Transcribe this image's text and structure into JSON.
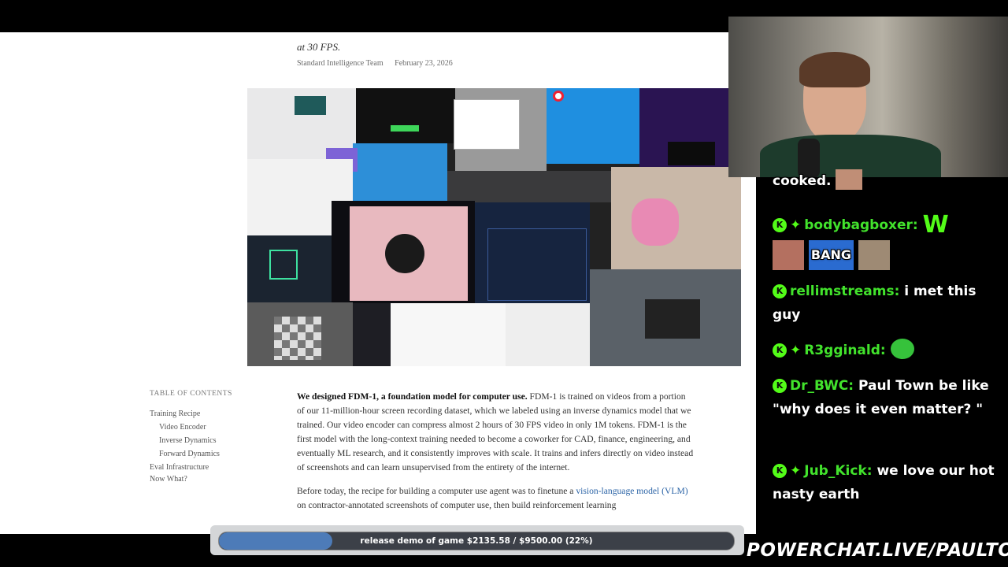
{
  "article": {
    "lede": "at 30 FPS.",
    "author": "Standard Intelligence Team",
    "date": "February 23, 2026",
    "toc": {
      "title": "TABLE OF CONTENTS",
      "items": [
        {
          "label": "Training Recipe",
          "sub": false
        },
        {
          "label": "Video Encoder",
          "sub": true
        },
        {
          "label": "Inverse Dynamics",
          "sub": true
        },
        {
          "label": "Forward Dynamics",
          "sub": true
        },
        {
          "label": "Eval Infrastructure",
          "sub": false
        },
        {
          "label": "Now What?",
          "sub": false
        }
      ]
    },
    "p1_bold": "We designed FDM-1, a foundation model for computer use.",
    "p1_rest": " FDM-1 is trained on videos from a portion of our 11-million-hour screen recording dataset, which we labeled using an inverse dynamics model that we trained. Our video encoder can compress almost 2 hours of 30 FPS video in only 1M tokens. FDM-1 is the first model with the long-context training needed to become a coworker for CAD, finance, engineering, and eventually ML research, and it consistently improves with scale. It trains and infers directly on video instead of screenshots and can learn unsupervised from the entirety of the internet.",
    "p2_start": "Before today, the recipe for building a computer use agent was to finetune a ",
    "p2_link": "vision-language model (VLM)",
    "p2_end": " on contractor-annotated screenshots of computer use, then build reinforcement learning"
  },
  "chat": {
    "messages": [
      {
        "user": "",
        "text": "cooked.",
        "badges": []
      },
      {
        "user": "bodybagboxer:",
        "text": "W",
        "badges": [
          "K",
          "sparkle"
        ]
      },
      {
        "user": "",
        "text": "BANG",
        "badges": []
      },
      {
        "user": "rellimstreams:",
        "text": "i met this guy",
        "badges": [
          "K"
        ]
      },
      {
        "user": "R3gginald:",
        "text": "",
        "badges": [
          "K",
          "sparkle"
        ]
      },
      {
        "user": "Dr_BWC:",
        "text": "Paul Town be like \"why does it even matter? \"",
        "badges": [
          "K"
        ]
      },
      {
        "user": "Jub_Kick:",
        "text": "we love our hot nasty earth",
        "badges": [
          "K",
          "sparkle"
        ]
      }
    ]
  },
  "goal": {
    "label": "release demo of game $2135.58 / $9500.00 (22%)",
    "progress": 0.22
  },
  "promo": "POWERCHAT.LIVE/PAULTOWN",
  "colors": {
    "kick_green": "#53fc18",
    "username_green": "#42e32c",
    "link_blue": "#2a63a6",
    "goal_fill": "#4d7bb8"
  },
  "icons": [
    "kick-badge-icon",
    "sparkle-badge-icon",
    "cursor-icon"
  ]
}
